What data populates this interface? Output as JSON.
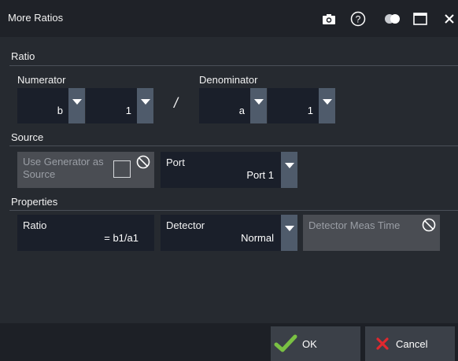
{
  "window": {
    "title": "More Ratios",
    "icons": [
      "camera-icon",
      "help-icon",
      "toggle-icon",
      "maximize-icon",
      "close-icon"
    ]
  },
  "sections": {
    "ratio": "Ratio",
    "source": "Source",
    "properties": "Properties"
  },
  "ratio": {
    "numerator_label": "Numerator",
    "denominator_label": "Denominator",
    "separator": "/",
    "numerator_wave": "b",
    "numerator_port": "1",
    "denominator_wave": "a",
    "denominator_port": "1"
  },
  "source": {
    "use_generator_label": "Use Generator as Source",
    "port_label": "Port",
    "port_value": "Port 1"
  },
  "properties": {
    "ratio_label": "Ratio",
    "ratio_value": "= b1/a1",
    "detector_label": "Detector",
    "detector_value": "Normal",
    "meas_time_label": "Detector Meas Time"
  },
  "footer": {
    "ok_label": "OK",
    "cancel_label": "Cancel"
  },
  "colors": {
    "accent_green": "#7ac143",
    "cancel_red": "#e0282e",
    "field_bg": "#1a1f2a",
    "arrow_bg": "#4f5b6b"
  }
}
